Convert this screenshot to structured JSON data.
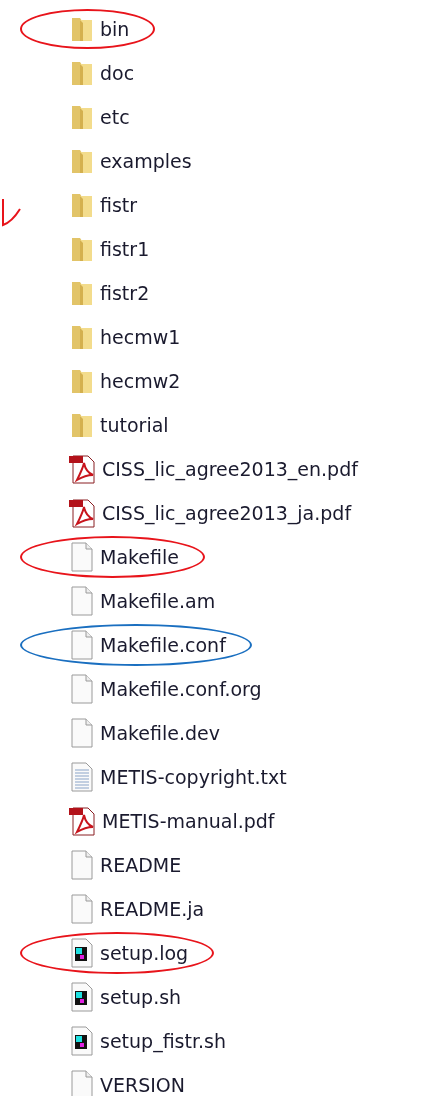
{
  "files": [
    {
      "name": "bin",
      "kind": "folder",
      "circled": true,
      "color": "#e8141b"
    },
    {
      "name": "doc",
      "kind": "folder",
      "circled": false
    },
    {
      "name": "etc",
      "kind": "folder",
      "circled": false
    },
    {
      "name": "examples",
      "kind": "folder",
      "circled": false
    },
    {
      "name": "fistr",
      "kind": "folder",
      "circled": false
    },
    {
      "name": "fistr1",
      "kind": "folder",
      "circled": false
    },
    {
      "name": "fistr2",
      "kind": "folder",
      "circled": false
    },
    {
      "name": "hecmw1",
      "kind": "folder",
      "circled": false
    },
    {
      "name": "hecmw2",
      "kind": "folder",
      "circled": false
    },
    {
      "name": "tutorial",
      "kind": "folder",
      "circled": false
    },
    {
      "name": "CISS_lic_agree2013_en.pdf",
      "kind": "pdf",
      "circled": false
    },
    {
      "name": "CISS_lic_agree2013_ja.pdf",
      "kind": "pdf",
      "circled": false
    },
    {
      "name": "Makefile",
      "kind": "file",
      "circled": true,
      "color": "#e8141b"
    },
    {
      "name": "Makefile.am",
      "kind": "file",
      "circled": false
    },
    {
      "name": "Makefile.conf",
      "kind": "file",
      "circled": true,
      "color": "#1a6fc0"
    },
    {
      "name": "Makefile.conf.org",
      "kind": "file",
      "circled": false
    },
    {
      "name": "Makefile.dev",
      "kind": "file",
      "circled": false
    },
    {
      "name": "METIS-copyright.txt",
      "kind": "text",
      "circled": false
    },
    {
      "name": "METIS-manual.pdf",
      "kind": "pdf",
      "circled": false
    },
    {
      "name": "README",
      "kind": "file",
      "circled": false
    },
    {
      "name": "README.ja",
      "kind": "file",
      "circled": false
    },
    {
      "name": "setup.log",
      "kind": "script",
      "circled": true,
      "color": "#e8141b"
    },
    {
      "name": "setup.sh",
      "kind": "script",
      "circled": false
    },
    {
      "name": "setup_fistr.sh",
      "kind": "script",
      "circled": false
    },
    {
      "name": "VERSION",
      "kind": "file",
      "circled": false
    }
  ]
}
